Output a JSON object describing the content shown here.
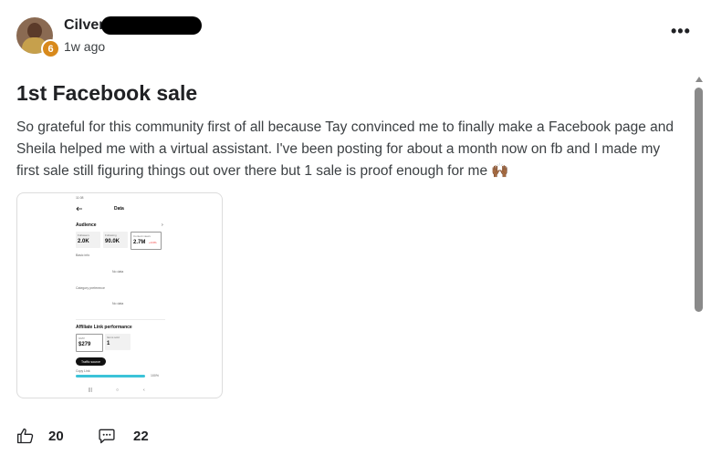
{
  "post": {
    "author": "Cilver",
    "level": "6",
    "time": "1w ago",
    "more_label": "•••",
    "title": "1st Facebook sale",
    "body": "So grateful for this community first of all because Tay convinced me to finally make a Facebook page and Sheila helped me with a virtual assistant. I've been posting for about a month now on fb and I made my first sale still figuring things out over there but 1 sale is proof enough for me 🙌🏾",
    "attachment": {
      "status_time": "11:08",
      "screen_title": "Data",
      "audience_heading": "Audience",
      "stats": [
        {
          "label": "Followers",
          "value": "2.0K",
          "change": ""
        },
        {
          "label": "Following",
          "value": "90.0K",
          "change": ""
        },
        {
          "label": "Content views",
          "value": "2.7M",
          "change": "+0.0%"
        }
      ],
      "basic_info": "Basic info",
      "no_data_1": "No data",
      "category_preference": "Category preference",
      "no_data_2": "No data",
      "affiliate_heading": "Affiliate Link performance",
      "gmv_label": "GMV",
      "gmv_value": "$279",
      "items_sold_label": "Items sold",
      "items_sold_value": "1",
      "traffic_button": "Traffic source",
      "copy_link": "Copy Link",
      "progress_percent": "100%"
    }
  },
  "actions": {
    "like_count": "20",
    "comment_count": "22"
  },
  "colors": {
    "badge": "#d8891b",
    "progress": "#3bc3d8",
    "scrollbar": "#8a8a8a"
  },
  "icons": [
    "more-icon",
    "thumbs-up-icon",
    "comment-icon",
    "back-arrow-icon"
  ]
}
